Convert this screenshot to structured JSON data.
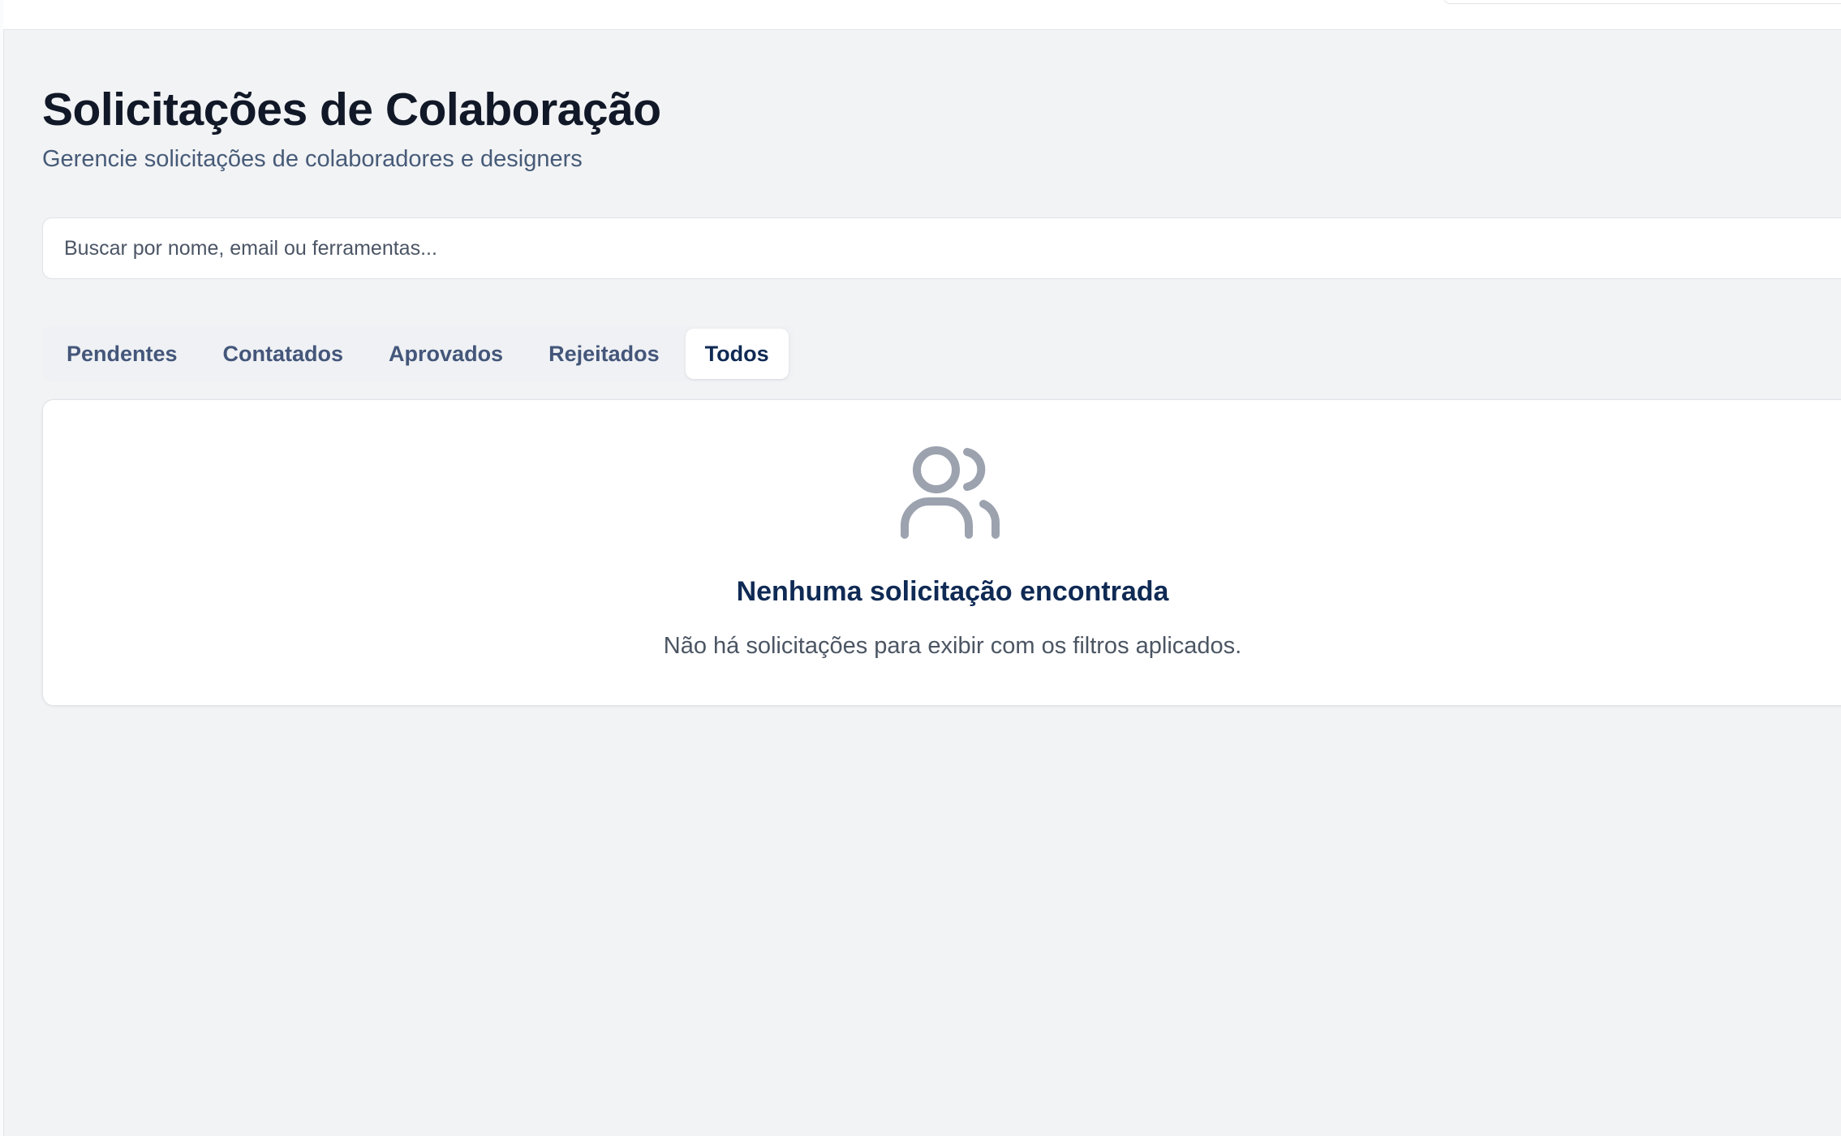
{
  "header": {
    "title": "Solicitações de Colaboração",
    "subtitle": "Gerencie solicitações de colaboradores e designers"
  },
  "search": {
    "placeholder": "Buscar por nome, email ou ferramentas..."
  },
  "tabs": [
    {
      "label": "Pendentes",
      "active": false
    },
    {
      "label": "Contatados",
      "active": false
    },
    {
      "label": "Aprovados",
      "active": false
    },
    {
      "label": "Rejeitados",
      "active": false
    },
    {
      "label": "Todos",
      "active": true
    }
  ],
  "empty_state": {
    "icon": "users-icon",
    "title": "Nenhuma solicitação encontrada",
    "description": "Não há solicitações para exibir com os filtros aplicados."
  },
  "colors": {
    "page_background": "#f2f3f5",
    "card_background": "#ffffff",
    "title_text": "#111827",
    "subtitle_text": "#475b78",
    "tab_text": "#44567a",
    "tab_active_text": "#0f2a54",
    "icon": "#9ca3af"
  }
}
